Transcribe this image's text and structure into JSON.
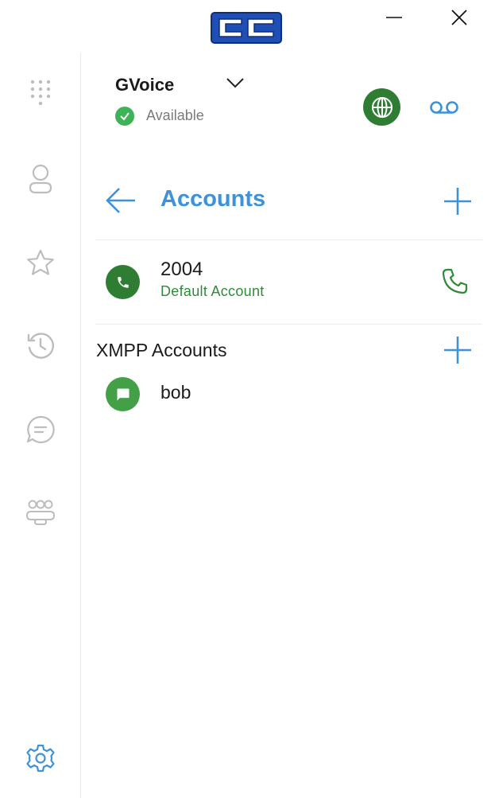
{
  "app": {
    "logo_text": "CC"
  },
  "profile": {
    "name": "GVoice",
    "status": "Available",
    "status_color": "#3db257"
  },
  "header_actions": {
    "globe_icon": "globe-icon",
    "voicemail_icon": "voicemail-icon",
    "globe_bg": "#2e7d32",
    "accent": "#3d92d9"
  },
  "sidebar": {
    "items": [
      {
        "name": "dialpad",
        "icon": "dialpad-icon"
      },
      {
        "name": "contacts",
        "icon": "person-icon"
      },
      {
        "name": "favorites",
        "icon": "star-icon"
      },
      {
        "name": "history",
        "icon": "history-icon"
      },
      {
        "name": "chat",
        "icon": "chat-icon"
      },
      {
        "name": "groups",
        "icon": "group-icon"
      },
      {
        "name": "settings",
        "icon": "gear-icon"
      }
    ]
  },
  "page": {
    "title": "Accounts"
  },
  "accounts": [
    {
      "name": "2004",
      "subtitle": "Default Account"
    }
  ],
  "xmpp": {
    "section_title": "XMPP Accounts",
    "accounts": [
      {
        "name": "bob"
      }
    ]
  }
}
